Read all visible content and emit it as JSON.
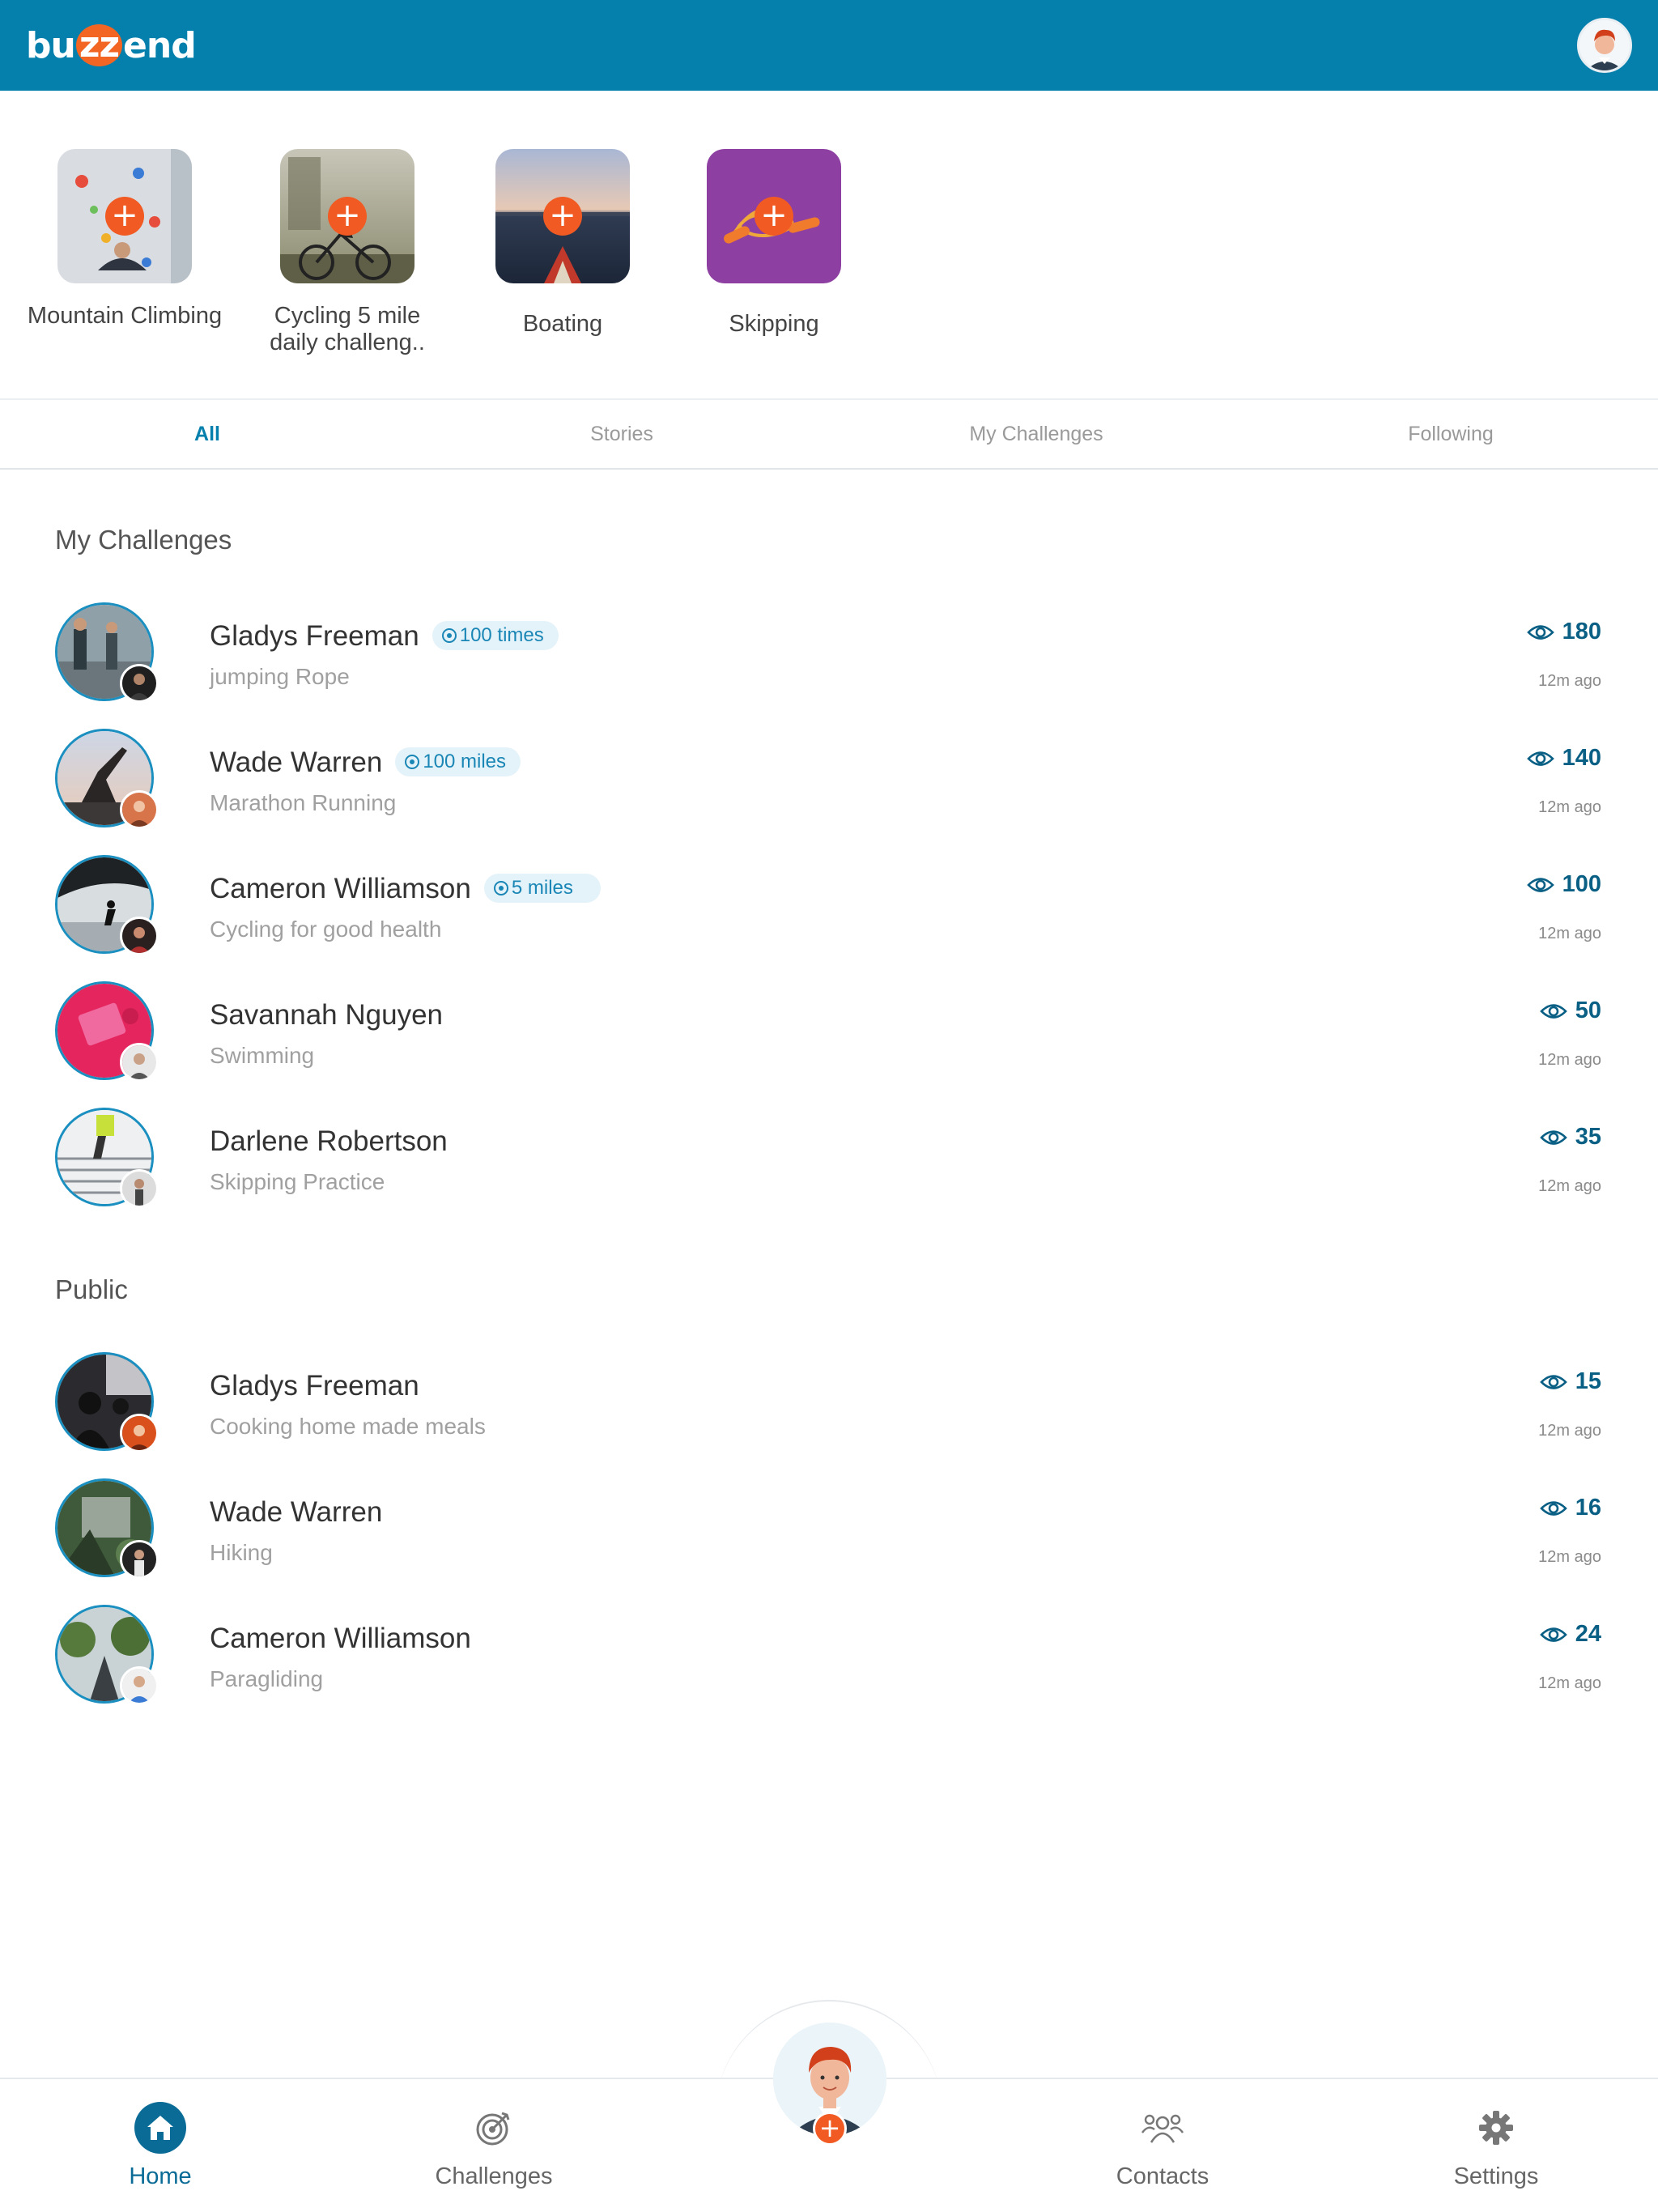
{
  "header": {
    "logo_left": "bu",
    "logo_z": "zz",
    "logo_right": "end"
  },
  "stories": [
    {
      "label": "Mountain Climbing"
    },
    {
      "label": "Cycling 5 mile daily challeng.."
    },
    {
      "label": "Boating"
    },
    {
      "label": "Skipping"
    }
  ],
  "tabs": [
    "All",
    "Stories",
    "My Challenges",
    "Following"
  ],
  "sections": {
    "my_challenges": {
      "title": "My Challenges",
      "items": [
        {
          "name": "Gladys Freeman",
          "badge": "100 times",
          "sub": "jumping Rope",
          "views": "180",
          "time": "12m ago"
        },
        {
          "name": "Wade Warren",
          "badge": "100 miles",
          "sub": "Marathon Running",
          "views": "140",
          "time": "12m ago"
        },
        {
          "name": "Cameron Williamson",
          "badge": "5 miles",
          "sub": "Cycling for good health",
          "views": "100",
          "time": "12m ago"
        },
        {
          "name": "Savannah Nguyen",
          "sub": "Swimming",
          "views": "50",
          "time": "12m ago"
        },
        {
          "name": "Darlene Robertson",
          "sub": "Skipping Practice",
          "views": "35",
          "time": "12m ago"
        }
      ]
    },
    "public": {
      "title": "Public",
      "items": [
        {
          "name": "Gladys Freeman",
          "sub": "Cooking home made meals",
          "views": "15",
          "time": "12m ago"
        },
        {
          "name": "Wade Warren",
          "sub": "Hiking",
          "views": "16",
          "time": "12m ago"
        },
        {
          "name": "Cameron Williamson",
          "sub": "Paragliding",
          "views": "24",
          "time": "12m ago"
        }
      ]
    }
  },
  "bottom_nav": {
    "home": "Home",
    "challenges": "Challenges",
    "contacts": "Contacts",
    "settings": "Settings"
  },
  "colors": {
    "header": "#0580ad",
    "accent": "#f15a22",
    "badge_bg": "#e4f3f9",
    "views": "#0a5f85"
  }
}
